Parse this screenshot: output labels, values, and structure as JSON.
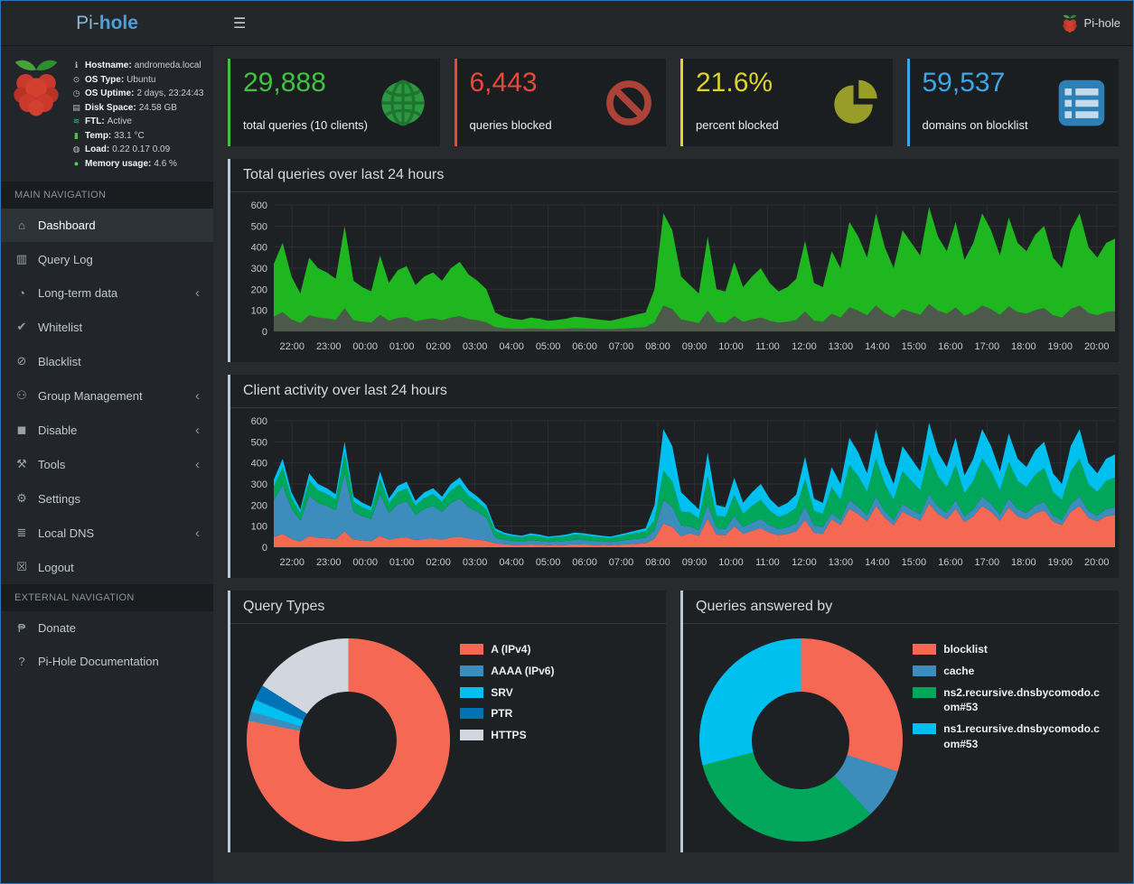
{
  "header": {
    "brand_pi": "Pi-",
    "brand_hole": "hole",
    "menu_icon": "☰",
    "app_label": "Pi-hole"
  },
  "sidebar": {
    "system": [
      {
        "icon": "hostname-icon",
        "glyph": "ℹ",
        "color": "#b9bfc4",
        "label": "Hostname:",
        "value": "andromeda.local"
      },
      {
        "icon": "os-type-icon",
        "glyph": "⊙",
        "color": "#b9bfc4",
        "label": "OS Type:",
        "value": "Ubuntu"
      },
      {
        "icon": "uptime-icon",
        "glyph": "◷",
        "color": "#b9bfc4",
        "label": "OS Uptime:",
        "value": "2 days, 23:24:43"
      },
      {
        "icon": "disk-space-icon",
        "glyph": "▤",
        "color": "#b9bfc4",
        "label": "Disk Space:",
        "value": "24.58 GB"
      },
      {
        "icon": "ftl-status-icon",
        "glyph": "≋",
        "color": "#35c06a",
        "label": "FTL:",
        "value": "Active"
      },
      {
        "icon": "temperature-icon",
        "glyph": "▮",
        "color": "#4ec04e",
        "label": "Temp:",
        "value": "33.1 °C"
      },
      {
        "icon": "load-icon",
        "glyph": "◍",
        "color": "#b9bfc4",
        "label": "Load:",
        "value": "0.22  0.17  0.09"
      },
      {
        "icon": "memory-icon",
        "glyph": "●",
        "color": "#58d058",
        "label": "Memory usage:",
        "value": "4.6 %"
      }
    ],
    "sections": [
      {
        "title": "MAIN NAVIGATION",
        "items": [
          {
            "label": "Dashboard",
            "icon": "home-icon",
            "glyph": "⌂",
            "active": true,
            "expandable": false
          },
          {
            "label": "Query Log",
            "icon": "file-icon",
            "glyph": "▥",
            "active": false,
            "expandable": false
          },
          {
            "label": "Long-term data",
            "icon": "clock-icon",
            "glyph": "◔",
            "active": false,
            "expandable": true
          },
          {
            "label": "Whitelist",
            "icon": "check-icon",
            "glyph": "✔",
            "active": false,
            "expandable": false
          },
          {
            "label": "Blacklist",
            "icon": "ban-icon",
            "glyph": "⊘",
            "active": false,
            "expandable": false
          },
          {
            "label": "Group Management",
            "icon": "users-icon",
            "glyph": "⚇",
            "active": false,
            "expandable": true
          },
          {
            "label": "Disable",
            "icon": "stop-icon",
            "glyph": "◼",
            "active": false,
            "expandable": true
          },
          {
            "label": "Tools",
            "icon": "tools-icon",
            "glyph": "⚒",
            "active": false,
            "expandable": true
          },
          {
            "label": "Settings",
            "icon": "gears-icon",
            "glyph": "⚙",
            "active": false,
            "expandable": false
          },
          {
            "label": "Local DNS",
            "icon": "dns-icon",
            "glyph": "≣",
            "active": false,
            "expandable": true
          },
          {
            "label": "Logout",
            "icon": "logout-icon",
            "glyph": "☒",
            "active": false,
            "expandable": false
          }
        ]
      },
      {
        "title": "EXTERNAL NAVIGATION",
        "items": [
          {
            "label": "Donate",
            "icon": "donate-icon",
            "glyph": "₱",
            "active": false,
            "expandable": false
          },
          {
            "label": "Pi-Hole Documentation",
            "icon": "help-icon",
            "glyph": "?",
            "active": false,
            "expandable": false
          }
        ]
      }
    ]
  },
  "cards": [
    {
      "value": "29,888",
      "label": "total queries (10 clients)",
      "accent": "#40c340",
      "icon": "globe-icon"
    },
    {
      "value": "6,443",
      "label": "queries blocked",
      "accent": "#e8483b",
      "icon": "ban-icon"
    },
    {
      "value": "21.6%",
      "label": "percent blocked",
      "accent": "#ddd22f",
      "icon": "pie-chart-icon"
    },
    {
      "value": "59,537",
      "label": "domains on blocklist",
      "accent": "#3ba7e8",
      "icon": "list-icon"
    }
  ],
  "panels": {
    "total_queries": {
      "title": "Total queries over last 24 hours"
    },
    "client_activity": {
      "title": "Client activity over last 24 hours"
    },
    "query_types": {
      "title": "Query Types"
    },
    "answered_by": {
      "title": "Queries answered by"
    }
  },
  "chart_data": [
    {
      "id": "total-queries",
      "type": "area",
      "mode": "overlay",
      "title": "Total queries over last 24 hours",
      "ylim": [
        0,
        600
      ],
      "y_ticks": [
        0,
        100,
        200,
        300,
        400,
        500,
        600
      ],
      "x_ticks": [
        "22:00",
        "23:00",
        "00:00",
        "01:00",
        "02:00",
        "03:00",
        "04:00",
        "05:00",
        "06:00",
        "07:00",
        "08:00",
        "09:00",
        "10:00",
        "11:00",
        "12:00",
        "13:00",
        "14:00",
        "15:00",
        "16:00",
        "17:00",
        "18:00",
        "19:00",
        "20:00"
      ],
      "grid": true,
      "legend_position": "none",
      "series": [
        {
          "name": "Total queries",
          "color": "#1fb71f",
          "values": [
            320,
            420,
            260,
            180,
            350,
            300,
            280,
            250,
            500,
            240,
            210,
            190,
            360,
            230,
            290,
            310,
            220,
            260,
            280,
            240,
            300,
            330,
            270,
            240,
            200,
            90,
            70,
            60,
            55,
            65,
            60,
            50,
            55,
            60,
            70,
            65,
            60,
            55,
            50,
            60,
            70,
            80,
            90,
            200,
            560,
            480,
            260,
            220,
            180,
            450,
            200,
            190,
            330,
            210,
            260,
            300,
            230,
            190,
            210,
            250,
            430,
            230,
            210,
            380,
            300,
            520,
            450,
            350,
            560,
            400,
            300,
            480,
            420,
            360,
            590,
            450,
            380,
            520,
            340,
            420,
            560,
            480,
            360,
            540,
            420,
            380,
            460,
            500,
            350,
            300,
            480,
            560,
            400,
            350,
            420,
            440
          ]
        },
        {
          "name": "Blocked queries",
          "color": "#4d594a",
          "values": [
            70,
            92,
            57,
            40,
            77,
            66,
            62,
            55,
            110,
            53,
            46,
            42,
            79,
            51,
            64,
            68,
            48,
            57,
            62,
            53,
            66,
            73,
            59,
            53,
            44,
            20,
            15,
            13,
            12,
            14,
            13,
            11,
            12,
            13,
            15,
            14,
            13,
            12,
            11,
            13,
            15,
            18,
            20,
            44,
            123,
            106,
            57,
            48,
            40,
            99,
            44,
            42,
            73,
            46,
            57,
            66,
            51,
            42,
            46,
            55,
            95,
            51,
            46,
            84,
            66,
            114,
            99,
            77,
            123,
            88,
            66,
            106,
            92,
            79,
            130,
            99,
            84,
            114,
            75,
            92,
            123,
            106,
            79,
            119,
            92,
            84,
            101,
            110,
            77,
            66,
            106,
            123,
            88,
            77,
            92,
            97
          ]
        }
      ]
    },
    {
      "id": "client-activity",
      "type": "area",
      "mode": "stacked",
      "title": "Client activity over last 24 hours",
      "ylim": [
        0,
        600
      ],
      "y_ticks": [
        0,
        100,
        200,
        300,
        400,
        500,
        600
      ],
      "x_ticks": [
        "22:00",
        "23:00",
        "00:00",
        "01:00",
        "02:00",
        "03:00",
        "04:00",
        "05:00",
        "06:00",
        "07:00",
        "08:00",
        "09:00",
        "10:00",
        "11:00",
        "12:00",
        "13:00",
        "14:00",
        "15:00",
        "16:00",
        "17:00",
        "18:00",
        "19:00",
        "20:00"
      ],
      "grid": true,
      "legend_position": "none",
      "series": [
        {
          "name": "client 1",
          "color": "#f56954",
          "values": [
            48,
            63,
            39,
            27,
            53,
            45,
            42,
            38,
            75,
            36,
            32,
            29,
            54,
            35,
            44,
            47,
            33,
            39,
            42,
            36,
            45,
            50,
            41,
            36,
            30,
            18,
            14,
            12,
            11,
            13,
            12,
            10,
            11,
            12,
            14,
            13,
            12,
            11,
            10,
            12,
            14,
            16,
            18,
            40,
            112,
            96,
            52,
            66,
            54,
            135,
            60,
            57,
            99,
            63,
            78,
            90,
            69,
            57,
            63,
            75,
            129,
            69,
            63,
            133,
            105,
            182,
            158,
            122,
            196,
            140,
            105,
            168,
            147,
            126,
            206,
            158,
            133,
            182,
            119,
            147,
            196,
            168,
            126,
            189,
            147,
            133,
            161,
            175,
            122,
            105,
            168,
            196,
            140,
            122,
            147,
            154
          ]
        },
        {
          "name": "client 2",
          "color": "#3c8dbc",
          "values": [
            176,
            231,
            143,
            99,
            193,
            165,
            154,
            138,
            275,
            132,
            116,
            105,
            198,
            127,
            160,
            171,
            121,
            143,
            154,
            132,
            165,
            182,
            149,
            132,
            110,
            27,
            21,
            18,
            17,
            20,
            18,
            15,
            17,
            18,
            21,
            20,
            18,
            17,
            15,
            18,
            21,
            24,
            27,
            40,
            112,
            96,
            52,
            33,
            27,
            68,
            30,
            29,
            50,
            32,
            39,
            45,
            35,
            29,
            32,
            38,
            65,
            35,
            32,
            30,
            24,
            42,
            36,
            28,
            45,
            32,
            24,
            38,
            34,
            29,
            47,
            36,
            30,
            42,
            27,
            34,
            45,
            38,
            29,
            43,
            34,
            30,
            37,
            40,
            28,
            24,
            38,
            45,
            32,
            28,
            34,
            35
          ]
        },
        {
          "name": "client 3",
          "color": "#00a65a",
          "values": [
            64,
            84,
            52,
            36,
            70,
            60,
            56,
            50,
            100,
            48,
            42,
            38,
            72,
            46,
            58,
            62,
            44,
            52,
            56,
            48,
            60,
            66,
            54,
            48,
            40,
            32,
            25,
            21,
            19,
            23,
            21,
            18,
            19,
            21,
            25,
            23,
            21,
            19,
            18,
            21,
            25,
            28,
            32,
            50,
            140,
            120,
            65,
            66,
            54,
            135,
            60,
            57,
            99,
            63,
            78,
            90,
            69,
            57,
            63,
            75,
            129,
            69,
            63,
            122,
            96,
            166,
            144,
            112,
            179,
            128,
            96,
            154,
            134,
            115,
            189,
            144,
            122,
            166,
            109,
            134,
            179,
            154,
            115,
            173,
            134,
            122,
            147,
            160,
            112,
            96,
            154,
            179,
            128,
            112,
            134,
            141
          ]
        },
        {
          "name": "client 4",
          "color": "#00c0ef",
          "values": [
            32,
            42,
            26,
            18,
            35,
            30,
            28,
            25,
            50,
            24,
            21,
            19,
            36,
            23,
            29,
            31,
            22,
            26,
            28,
            24,
            30,
            33,
            27,
            24,
            20,
            13,
            10,
            9,
            8,
            10,
            9,
            7,
            8,
            9,
            10,
            10,
            9,
            8,
            7,
            9,
            10,
            12,
            13,
            70,
            196,
            168,
            91,
            55,
            45,
            112,
            50,
            47,
            82,
            53,
            65,
            75,
            57,
            47,
            52,
            62,
            107,
            57,
            52,
            95,
            75,
            130,
            112,
            88,
            140,
            100,
            75,
            120,
            105,
            90,
            148,
            112,
            95,
            130,
            85,
            105,
            140,
            120,
            90,
            135,
            105,
            95,
            115,
            125,
            88,
            75,
            120,
            140,
            100,
            88,
            105,
            110
          ]
        }
      ]
    },
    {
      "id": "query-types",
      "type": "doughnut",
      "title": "Query Types",
      "labels": [
        "A (IPv4)",
        "AAAA (IPv6)",
        "SRV",
        "PTR",
        "HTTPS"
      ],
      "values": [
        78,
        1.5,
        2,
        2.5,
        16
      ],
      "colors": [
        "#f56954",
        "#3c8dbc",
        "#00c0ef",
        "#0073b7",
        "#d2d6de"
      ],
      "legend_position": "right"
    },
    {
      "id": "answered-by",
      "type": "doughnut",
      "title": "Queries answered by",
      "labels": [
        "blocklist",
        "cache",
        "ns2.recursive.dnsbycomodo.com#53",
        "ns1.recursive.dnsbycomodo.com#53"
      ],
      "values": [
        30,
        8,
        33,
        29
      ],
      "colors": [
        "#f56954",
        "#3c8dbc",
        "#00a65a",
        "#00c0ef"
      ],
      "legend_position": "right"
    }
  ]
}
